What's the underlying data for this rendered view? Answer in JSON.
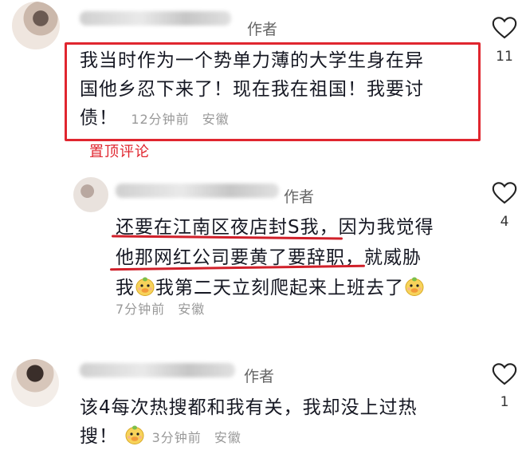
{
  "comments": [
    {
      "author_tag": "作者",
      "text_line1": "我当时作为一个势单力薄的大学生身在异",
      "text_line2": "国他乡忍下来了！现在我在祖国！我要讨",
      "text_line3": "债！",
      "time": "12分钟前",
      "location": "安徽",
      "likes": "11",
      "pin_label": "置顶评论"
    },
    {
      "author_tag": "作者",
      "text_line1_underlined": "还要在江南区夜店封S我",
      "text_line1_rest": "，因为我觉得",
      "text_line2_underlined": "他那网红公司要黄了要辞职",
      "text_line2_rest": "，就威胁",
      "text_line3_a": "我",
      "text_line3_b": "我第二天立刻爬起来上班去了",
      "time": "7分钟前",
      "location": "安徽",
      "likes": "4"
    },
    {
      "author_tag": "作者",
      "text_line1": "该4每次热搜都和我有关，我却没上过热",
      "text_line2": "搜！",
      "time": "3分钟前",
      "location": "安徽",
      "likes": "1"
    }
  ],
  "icons": {
    "like": "heart-outline-icon",
    "emoji": "duck-face-emoji-icon"
  },
  "colors": {
    "highlight_red": "#e0262f",
    "meta_gray": "#999999"
  }
}
